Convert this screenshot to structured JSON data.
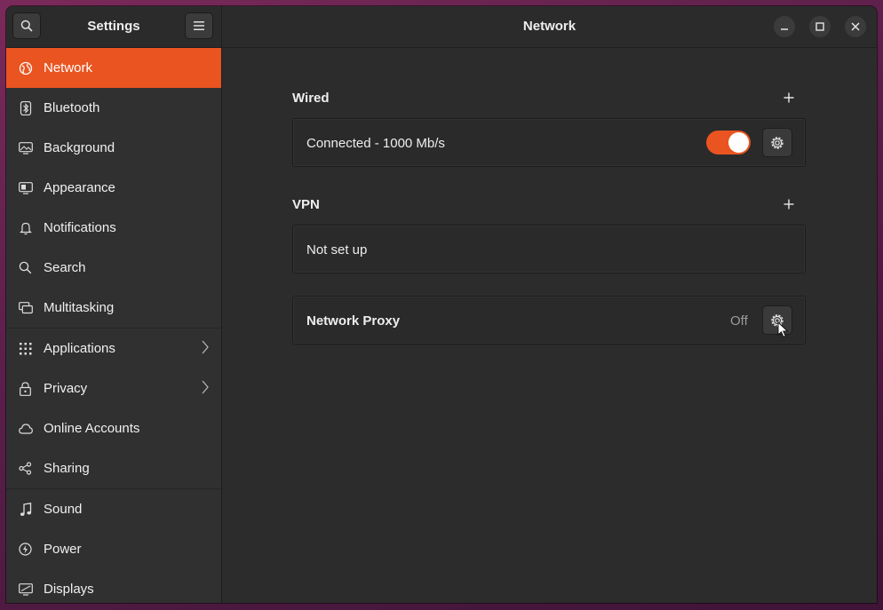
{
  "sidebar": {
    "title": "Settings",
    "items": [
      {
        "label": "Network",
        "icon": "globe-icon",
        "active": true
      },
      {
        "label": "Bluetooth",
        "icon": "bluetooth-icon"
      },
      {
        "label": "Background",
        "icon": "background-icon"
      },
      {
        "label": "Appearance",
        "icon": "appearance-icon"
      },
      {
        "label": "Notifications",
        "icon": "bell-icon"
      },
      {
        "label": "Search",
        "icon": "search-icon"
      },
      {
        "label": "Multitasking",
        "icon": "multitasking-icon"
      },
      {
        "label": "Applications",
        "icon": "grid-icon",
        "chevron": true
      },
      {
        "label": "Privacy",
        "icon": "lock-icon",
        "chevron": true
      },
      {
        "label": "Online Accounts",
        "icon": "cloud-icon"
      },
      {
        "label": "Sharing",
        "icon": "share-icon"
      },
      {
        "label": "Sound",
        "icon": "music-note-icon"
      },
      {
        "label": "Power",
        "icon": "power-icon"
      },
      {
        "label": "Displays",
        "icon": "display-icon"
      }
    ]
  },
  "header": {
    "title": "Network"
  },
  "wired": {
    "title": "Wired",
    "status": "Connected - 1000 Mb/s",
    "enabled": true
  },
  "vpn": {
    "title": "VPN",
    "status": "Not set up"
  },
  "proxy": {
    "title": "Network Proxy",
    "state": "Off"
  },
  "colors": {
    "accent": "#e95420",
    "background": "#2c2c2c",
    "sidebar": "#303030"
  }
}
